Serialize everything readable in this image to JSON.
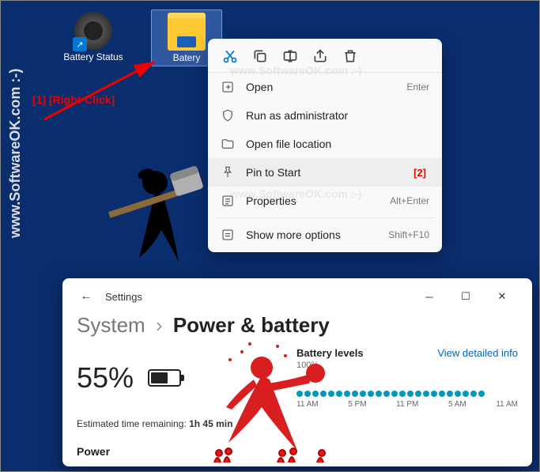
{
  "desktop": {
    "icons": [
      {
        "label": "Battery Status"
      },
      {
        "label": "Batery"
      }
    ]
  },
  "annotations": {
    "arrow_label": "[1] [Right-Click]",
    "step2": "[2]"
  },
  "watermark": "www.SoftwareOK.com :-)",
  "context_menu": {
    "items": [
      {
        "label": "Open",
        "shortcut": "Enter"
      },
      {
        "label": "Run as administrator",
        "shortcut": ""
      },
      {
        "label": "Open file location",
        "shortcut": ""
      },
      {
        "label": "Pin to Start",
        "shortcut": ""
      },
      {
        "label": "Properties",
        "shortcut": "Alt+Enter"
      },
      {
        "label": "Show more options",
        "shortcut": "Shift+F10"
      }
    ]
  },
  "settings": {
    "app_title": "Settings",
    "breadcrumb_root": "System",
    "breadcrumb_page": "Power & battery",
    "battery_pct": "55%",
    "estimated_label": "Estimated time remaining:",
    "estimated_value": "1h 45 min",
    "levels_title": "Battery levels",
    "levels_link": "View detailed info",
    "levels_scale": "100%",
    "chart_times": [
      "11 AM",
      "5 PM",
      "11 PM",
      "5 AM",
      "11 AM"
    ],
    "section_power": "Power"
  }
}
